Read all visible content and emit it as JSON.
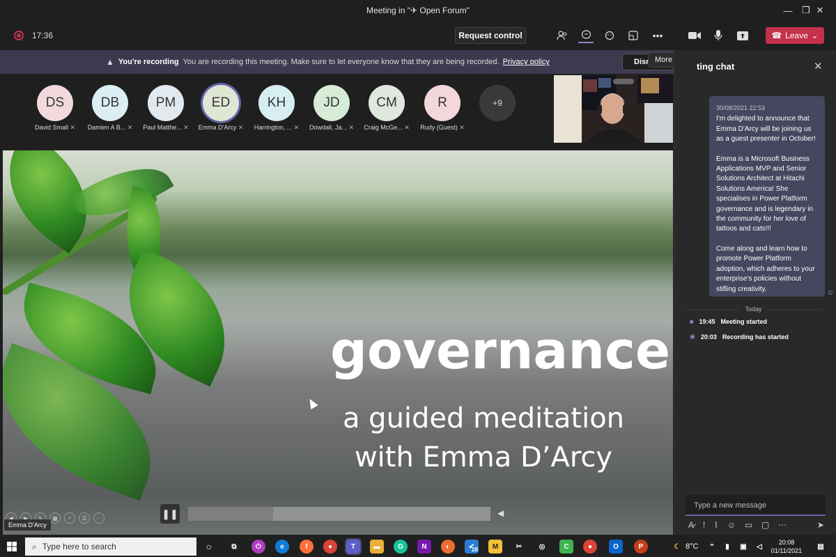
{
  "window": {
    "title": "Meeting in \"✈ Open Forum\"",
    "minimize": "—",
    "maximize": "❐",
    "close": "✕"
  },
  "topbar": {
    "timer": "17:36",
    "request_control": "Request control",
    "leave": "Leave",
    "icons": [
      "people-icon",
      "chat-icon",
      "reactions-icon",
      "rooms-icon",
      "more-icon",
      "camera-icon",
      "mic-icon",
      "share-icon"
    ]
  },
  "banner": {
    "title": "You're recording",
    "text": "You are recording this meeting. Make sure to let everyone know that they are being recorded.",
    "link": "Privacy policy",
    "dismiss": "Dism",
    "tooltip": "More actions"
  },
  "participants": [
    {
      "initials": "DS",
      "name": "David Small",
      "color": "#f2d9dc"
    },
    {
      "initials": "DB",
      "name": "Damien A B...",
      "color": "#dbeef3"
    },
    {
      "initials": "PM",
      "name": "Paul Matthe...",
      "color": "#e1e8ee"
    },
    {
      "initials": "ED",
      "name": "Emma D'Arcy",
      "color": "#e0e6d4"
    },
    {
      "initials": "KH",
      "name": "Harrington, ...",
      "color": "#d6eef2"
    },
    {
      "initials": "JD",
      "name": "Dowdall, Ja...",
      "color": "#d7ecd7"
    },
    {
      "initials": "CM",
      "name": "Craig McGe...",
      "color": "#dfe8dd"
    },
    {
      "initials": "R",
      "name": "Rudy (Guest)",
      "color": "#f4d7da"
    }
  ],
  "overflow_count": "+9",
  "slide": {
    "title": "governance",
    "line1": "a guided meditation",
    "line2": "with Emma D’Arcy",
    "progress": 0.28,
    "presenter": "Emma D'Arcy"
  },
  "chat": {
    "title": "Meeting chat",
    "title_visible": "ting chat",
    "message": {
      "timestamp": "30/08/2021 22:53",
      "paragraphs": [
        "I'm delighted to announce that Emma D'Arcy will be joining us as a guest presenter in October!",
        "Emma is a Microsoft Business Applications MVP and Senior Solutions Architect at Hitachi Solutions America! She specialises in Power Platform governance and is legendary in the community for her love of tattoos and cats!!!",
        "Come along and learn how to promote Power Platform adoption, which adheres to your enterprise's policies without stifling creativity."
      ]
    },
    "divider": "Today",
    "events": [
      {
        "time": "19:45",
        "text": "Meeting started"
      },
      {
        "time": "20:03",
        "text": "Recording has started"
      }
    ],
    "composer_placeholder": "Type a new message"
  },
  "taskbar": {
    "search_placeholder": "Type here to search",
    "temp": "8°C",
    "time": "20:08",
    "date": "01/11/2021",
    "badge": "28"
  }
}
